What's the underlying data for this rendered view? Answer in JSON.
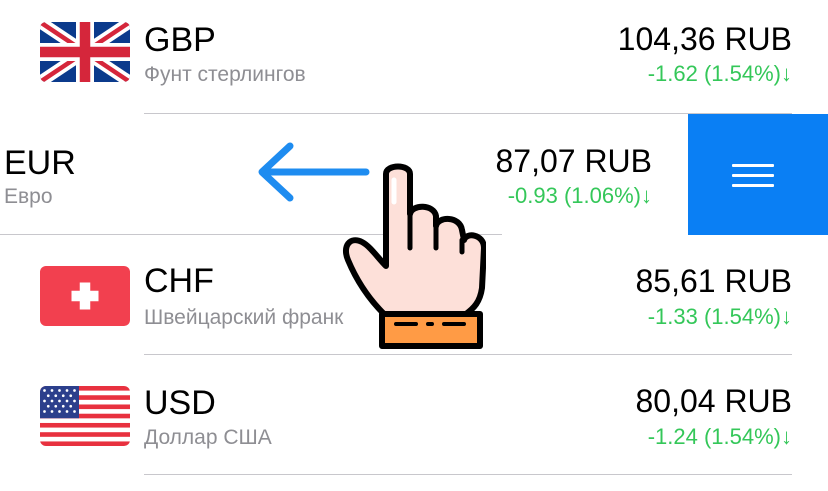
{
  "rows": [
    {
      "code": "GBP",
      "name": "Фунт стерлингов",
      "rate": "104,36 RUB",
      "change": "-1.62 (1.54%)↓",
      "flag": "uk-flag-icon"
    },
    {
      "code": "EUR",
      "name": "Евро",
      "rate": "87,07 RUB",
      "change": "-0.93 (1.06%)↓",
      "flag": "eu-flag-icon"
    },
    {
      "code": "CHF",
      "name": "Швейцарский франк",
      "rate": "85,61 RUB",
      "change": "-1.33 (1.54%)↓",
      "flag": "swiss-flag-icon"
    },
    {
      "code": "USD",
      "name": "Доллар США",
      "rate": "80,04 RUB",
      "change": "-1.24 (1.54%)↓",
      "flag": "us-flag-icon"
    }
  ],
  "swipe_action": {
    "icon": "menu-icon",
    "color": "#0a7ff4"
  },
  "colors": {
    "positive_change": "#34c759",
    "secondary_text": "#8e8e93",
    "divider": "#c8c7cc",
    "arrow": "#1e8cf0"
  },
  "overlay": {
    "arrow_icon": "arrow-left-icon",
    "hand_icon": "pointing-hand-icon"
  }
}
